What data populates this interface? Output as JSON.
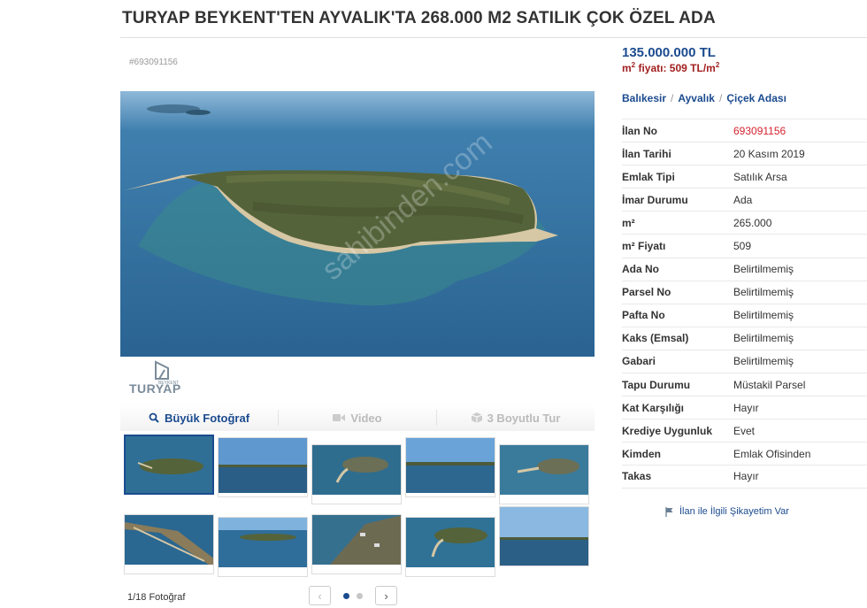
{
  "listing": {
    "title": "TURYAP BEYKENT'TEN AYVALIK'TA 268.000 M2 SATILIK ÇOK ÖZEL ADA",
    "code": "#693091156",
    "price": "135.000.000 TL",
    "unit_price_prefix": "m",
    "unit_price_sup": "2",
    "unit_price_rest": " fiyatı: 509 TL/m",
    "unit_price_sup2": "2"
  },
  "breadcrumb": {
    "items": [
      "Balıkesir",
      "Ayvalık",
      "Çiçek Adası"
    ],
    "separator": "/"
  },
  "details": [
    {
      "key": "İlan No",
      "value": "693091156",
      "highlight": true
    },
    {
      "key": "İlan Tarihi",
      "value": "20 Kasım 2019"
    },
    {
      "key": "Emlak Tipi",
      "value": "Satılık Arsa"
    },
    {
      "key": "İmar Durumu",
      "value": "Ada"
    },
    {
      "key": "m²",
      "value": "265.000"
    },
    {
      "key": "m² Fiyatı",
      "value": "509"
    },
    {
      "key": "Ada No",
      "value": "Belirtilmemiş"
    },
    {
      "key": "Parsel No",
      "value": "Belirtilmemiş"
    },
    {
      "key": "Pafta No",
      "value": "Belirtilmemiş"
    },
    {
      "key": "Kaks (Emsal)",
      "value": "Belirtilmemiş"
    },
    {
      "key": "Gabari",
      "value": "Belirtilmemiş"
    },
    {
      "key": "Tapu Durumu",
      "value": "Müstakil Parsel"
    },
    {
      "key": "Kat Karşılığı",
      "value": "Hayır"
    },
    {
      "key": "Krediye Uygunluk",
      "value": "Evet"
    },
    {
      "key": "Kimden",
      "value": "Emlak Ofisinden"
    },
    {
      "key": "Takas",
      "value": "Hayır"
    }
  ],
  "complaint_link": "İlan ile İlgili Şikayetim Var",
  "logo": {
    "text": "TURYAP",
    "small": "BEYKENT"
  },
  "watermark": "sahibinden.com",
  "media_tabs": [
    {
      "label": "Büyük Fotoğraf",
      "icon": "search-icon",
      "active": true
    },
    {
      "label": "Video",
      "icon": "video-camera-icon",
      "active": false
    },
    {
      "label": "3 Boyutlu Tur",
      "icon": "cube-icon",
      "active": false
    }
  ],
  "gallery": {
    "counter": "1/18 Fotoğraf",
    "page_dots": 2,
    "active_page": 1,
    "prev": "‹",
    "next": "›"
  },
  "colors": {
    "link": "#1b4b8f",
    "price_red": "#a32020",
    "id_red": "#d4232f",
    "sea": "#2f6f9a"
  }
}
